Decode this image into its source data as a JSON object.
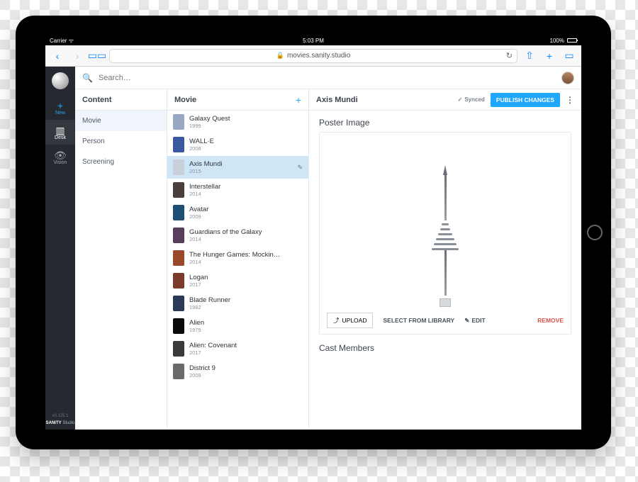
{
  "status": {
    "carrier": "Carrier",
    "time": "5:03 PM",
    "battery": "100%"
  },
  "browser": {
    "url": "movies.sanity.studio"
  },
  "rail": {
    "items": [
      {
        "icon": "+",
        "label": "New"
      },
      {
        "icon": "▥",
        "label": "Desk"
      },
      {
        "icon": "👁",
        "label": "Vision"
      }
    ],
    "version": "v0.125.1",
    "brand_a": "SANITY",
    "brand_b": "Studio"
  },
  "search": {
    "placeholder": "Search…"
  },
  "content": {
    "header": "Content",
    "items": [
      "Movie",
      "Person",
      "Screening"
    ],
    "selected": 0
  },
  "movies": {
    "header": "Movie",
    "items": [
      {
        "title": "Galaxy Quest",
        "year": "1999",
        "c": "#9aa7c2"
      },
      {
        "title": "WALL·E",
        "year": "2008",
        "c": "#3a5aa0"
      },
      {
        "title": "Axis Mundi",
        "year": "2015",
        "c": "#c7d0d8",
        "selected": true
      },
      {
        "title": "Interstellar",
        "year": "2014",
        "c": "#4a3f3a"
      },
      {
        "title": "Avatar",
        "year": "2009",
        "c": "#1e4e72"
      },
      {
        "title": "Guardians of the Galaxy",
        "year": "2014",
        "c": "#5a3e5e"
      },
      {
        "title": "The Hunger Games: Mockin…",
        "year": "2014",
        "c": "#9a4a2a"
      },
      {
        "title": "Logan",
        "year": "2017",
        "c": "#7a3b2a"
      },
      {
        "title": "Blade Runner",
        "year": "1982",
        "c": "#2b3a5a"
      },
      {
        "title": "Alien",
        "year": "1979",
        "c": "#0a0a0a"
      },
      {
        "title": "Alien: Covenant",
        "year": "2017",
        "c": "#3a3a3a"
      },
      {
        "title": "District 9",
        "year": "2009",
        "c": "#6a6a6a"
      }
    ]
  },
  "detail": {
    "title": "Axis Mundi",
    "synced": "Synced",
    "publish": "PUBLISH CHANGES",
    "poster_label": "Poster Image",
    "upload": "UPLOAD",
    "select_lib": "SELECT FROM LIBRARY",
    "edit": "EDIT",
    "remove": "REMOVE",
    "cast_label": "Cast Members"
  }
}
